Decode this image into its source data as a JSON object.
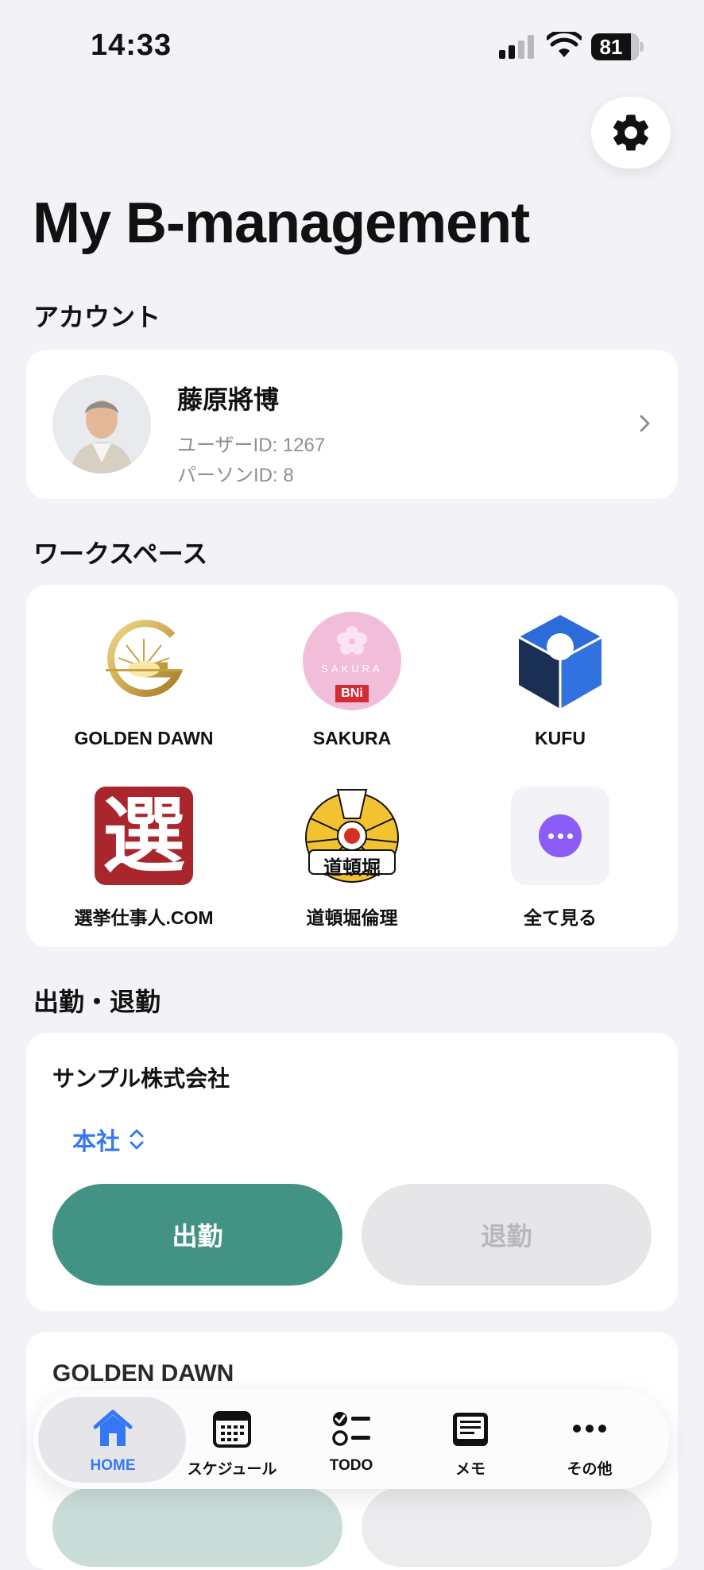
{
  "status_bar": {
    "time": "14:33",
    "battery": "81"
  },
  "header": {
    "title": "My B-management"
  },
  "account_section": {
    "label": "アカウント",
    "name": "藤原將博",
    "user_id": "ユーザーID: 1267",
    "person_id": "パーソンID: 8"
  },
  "workspace_section": {
    "label": "ワークスペース",
    "items": [
      {
        "label": "GOLDEN DAWN",
        "icon": "golden-dawn-logo"
      },
      {
        "label": "SAKURA",
        "icon": "sakura-bni-logo",
        "logo_text": "SAKURA",
        "logo_badge": "BNi"
      },
      {
        "label": "KUFU",
        "icon": "kufu-cube-logo"
      },
      {
        "label": "選挙仕事人.COM",
        "icon": "senkyo-logo",
        "logo_text": "選"
      },
      {
        "label": "道頓堀倫理",
        "icon": "dotonbori-logo",
        "logo_text": "道頓堀"
      },
      {
        "label": "全て見る",
        "icon": "more-icon"
      }
    ]
  },
  "attendance_section": {
    "label": "出勤・退勤",
    "company": "サンプル株式会社",
    "branch": "本社",
    "clock_in_label": "出勤",
    "clock_out_label": "退勤"
  },
  "second_card": {
    "title": "GOLDEN DAWN"
  },
  "tabbar": {
    "active": "HOME",
    "items": [
      {
        "label": "HOME",
        "icon": "home-icon"
      },
      {
        "label": "スケジュール",
        "icon": "calendar-icon"
      },
      {
        "label": "TODO",
        "icon": "todo-icon"
      },
      {
        "label": "メモ",
        "icon": "memo-icon"
      },
      {
        "label": "その他",
        "icon": "more-dots-icon"
      }
    ]
  },
  "colors": {
    "background": "#f2f2f7",
    "accent_blue": "#3478f6",
    "clock_in_green": "#439384",
    "disabled_gray": "#e6e6e8",
    "more_purple": "#8b5cf6"
  }
}
